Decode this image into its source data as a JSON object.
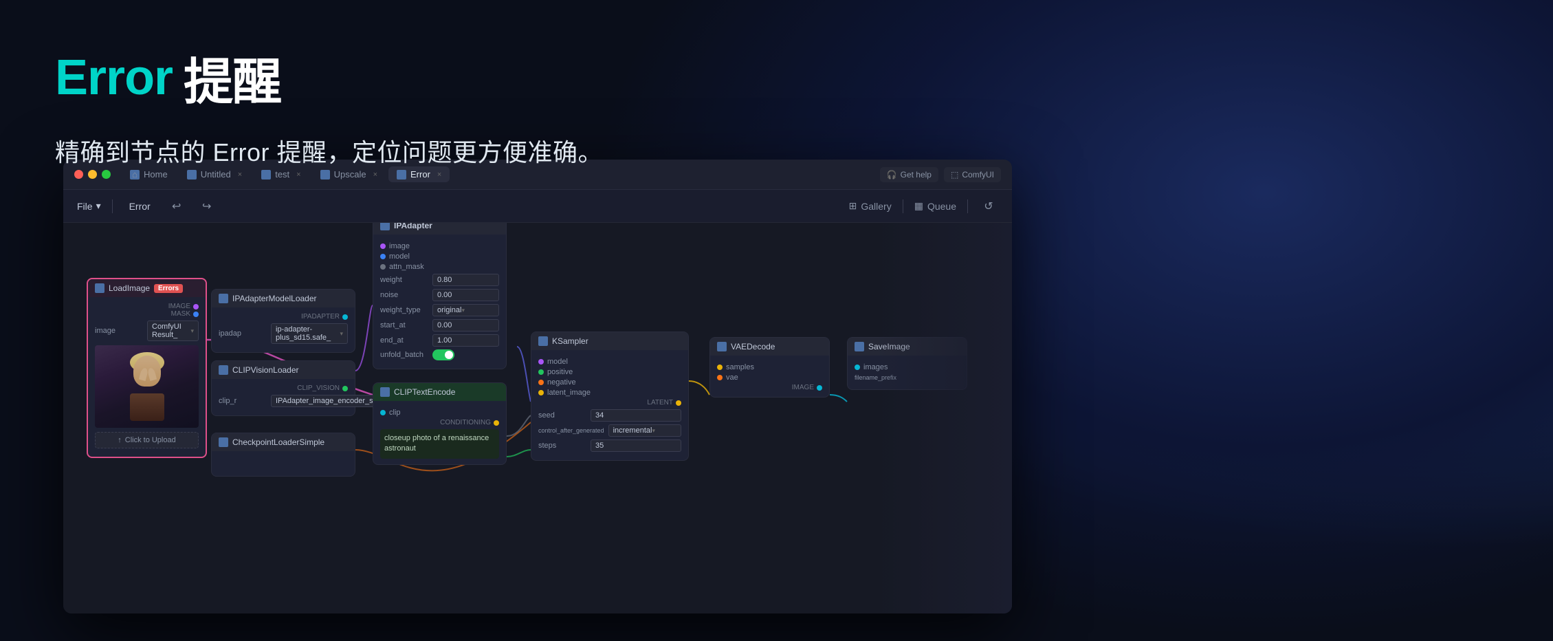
{
  "background": {
    "gradient_color1": "#1a2a5e",
    "gradient_color2": "#0d1535"
  },
  "header": {
    "title_error": "Error",
    "title_space": " ",
    "title_reminder": "提醒",
    "subtitle": "精确到节点的 Error 提醒，定位问题更方便准确。"
  },
  "window": {
    "title_bar": {
      "traffic_lights": [
        "red",
        "yellow",
        "green"
      ],
      "tabs": [
        {
          "label": "Home",
          "icon": "home-icon",
          "active": false,
          "closable": false
        },
        {
          "label": "Untitled",
          "icon": "node-icon",
          "active": false,
          "closable": true
        },
        {
          "label": "test",
          "icon": "node-icon",
          "active": false,
          "closable": true
        },
        {
          "label": "Upscale",
          "icon": "node-icon",
          "active": false,
          "closable": true
        },
        {
          "label": "Error",
          "icon": "node-icon",
          "active": true,
          "closable": true
        }
      ],
      "get_help": "Get help",
      "comfy_ui": "ComfyUI"
    },
    "toolbar": {
      "file_label": "File",
      "error_label": "Error",
      "undo_icon": "↩",
      "redo_icon": "↪",
      "gallery_label": "Gallery",
      "queue_label": "Queue",
      "refresh_icon": "↺"
    }
  },
  "nodes": {
    "load_image": {
      "title": "LoadImage",
      "badge": "Errors",
      "port_image": "IMAGE",
      "port_mask": "MASK",
      "image_label": "image",
      "image_value": "ComfyUI Result_",
      "upload_label": "Click to Upload"
    },
    "ipadapter_model": {
      "title": "IPAdapterModelLoader",
      "port_ipadapter": "IPADAPTER",
      "label_ipadap": "ipadap",
      "value_ipadap": "ip-adapter-plus_sd15.safe_"
    },
    "clip_vision": {
      "title": "CLIPVisionLoader",
      "port_clip_vision": "CLIP_VISION",
      "label_clip_r": "clip_r",
      "value_clip_r": "IPAdapter_image_encoder_s_"
    },
    "checkpoint": {
      "title": "CheckpointLoaderSimple"
    },
    "ipadapter_main": {
      "title": "IPAdapter",
      "port_image": "image",
      "port_model": "model",
      "port_attn_mask": "attn_mask",
      "label_weight": "weight",
      "value_weight": "0.80",
      "label_noise": "noise",
      "value_noise": "0.00",
      "label_weight_type": "weight_type",
      "value_weight_type": "original",
      "label_start_at": "start_at",
      "value_start_at": "0.00",
      "label_end_at": "end_at",
      "value_end_at": "1.00",
      "label_unfold_batch": "unfold_batch",
      "toggle_state": "on"
    },
    "clip_text_encode": {
      "title": "CLIPTextEncode",
      "port_clip": "clip",
      "port_conditioning": "CONDITIONING",
      "text_value": "closeup photo of a\nrenaissance astronaut"
    },
    "ksampler": {
      "title": "KSampler",
      "port_model": "model",
      "port_positive": "positive",
      "port_negative": "negative",
      "port_latent_image": "latent_image",
      "port_latent": "LATENT",
      "label_seed": "seed",
      "value_seed": "34",
      "label_control": "control_after_generated",
      "value_control": "incremental",
      "label_steps": "steps",
      "value_steps": "35"
    },
    "vae_decode": {
      "title": "VAEDecode",
      "port_samples": "samples",
      "port_vae": "vae",
      "port_image": "IMAGE"
    },
    "save_image": {
      "title": "SaveImage",
      "port_images": "images",
      "label_filename": "filename_prefix"
    }
  }
}
